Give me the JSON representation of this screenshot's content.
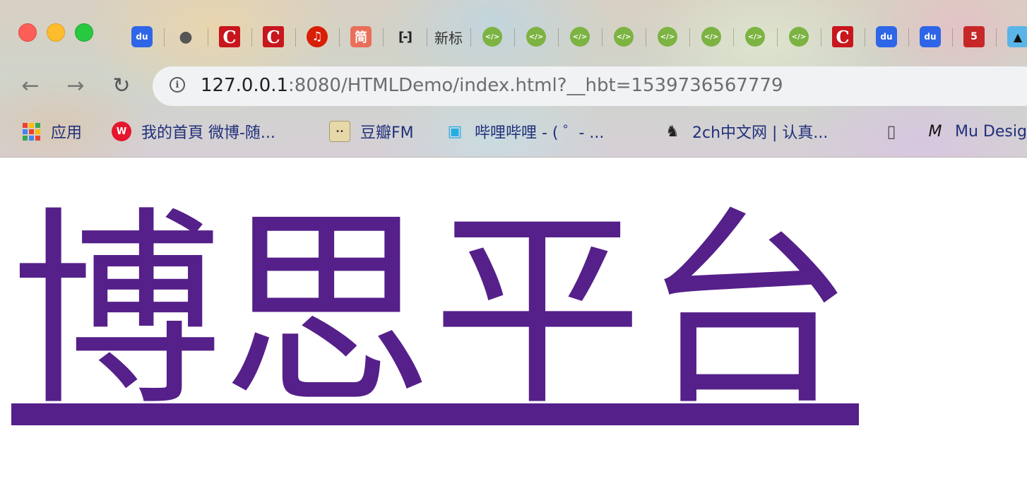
{
  "window": {
    "controls": [
      "close",
      "minimize",
      "zoom"
    ]
  },
  "tabs": [
    {
      "icon": "baidu-icon",
      "glyph": "du"
    },
    {
      "icon": "apple-icon",
      "glyph": ""
    },
    {
      "icon": "csdn-icon",
      "glyph": "C"
    },
    {
      "icon": "csdn-icon",
      "glyph": "C"
    },
    {
      "icon": "netease-music-icon",
      "glyph": "♫"
    },
    {
      "icon": "jianshu-icon",
      "glyph": "简"
    },
    {
      "icon": "aliyun-icon",
      "glyph": "[-]"
    },
    {
      "icon": "text-tab",
      "text": "新标"
    },
    {
      "icon": "code-icon",
      "glyph": "</>"
    },
    {
      "icon": "code-icon",
      "glyph": "</>"
    },
    {
      "icon": "code-icon",
      "glyph": "</>"
    },
    {
      "icon": "code-icon",
      "glyph": "</>"
    },
    {
      "icon": "code-icon",
      "glyph": "</>"
    },
    {
      "icon": "code-icon",
      "glyph": "</>"
    },
    {
      "icon": "code-icon",
      "glyph": "</>"
    },
    {
      "icon": "code-icon",
      "glyph": "</>"
    },
    {
      "icon": "csdn-icon",
      "glyph": "C"
    },
    {
      "icon": "baidu-icon",
      "glyph": "du"
    },
    {
      "icon": "baidu-icon",
      "glyph": "du"
    },
    {
      "icon": "html5-icon",
      "glyph": "5"
    },
    {
      "icon": "bird-icon",
      "glyph": "▲"
    }
  ],
  "toolbar": {
    "back_glyph": "←",
    "forward_glyph": "→",
    "reload_glyph": "↻"
  },
  "address_bar": {
    "host": "127.0.0.1",
    "rest": ":8080/HTMLDemo/index.html?__hbt=1539736567779"
  },
  "bookmarks": [
    {
      "label": "应用",
      "icon": "apps-grid-icon"
    },
    {
      "label": "我的首頁 微博-随...",
      "icon": "weibo-icon"
    },
    {
      "label": "豆瓣FM",
      "icon": "douban-fm-icon"
    },
    {
      "label": "哔哩哔哩 - ( ゜- ...",
      "icon": "bilibili-icon"
    },
    {
      "label": "2ch中文网 | 认真...",
      "icon": "2ch-icon"
    },
    {
      "label": "",
      "icon": "document-icon"
    },
    {
      "label": "Mu Desig",
      "icon": "mu-design-icon"
    }
  ],
  "page": {
    "link_text": "博思平台",
    "link_color": "#55208a"
  }
}
